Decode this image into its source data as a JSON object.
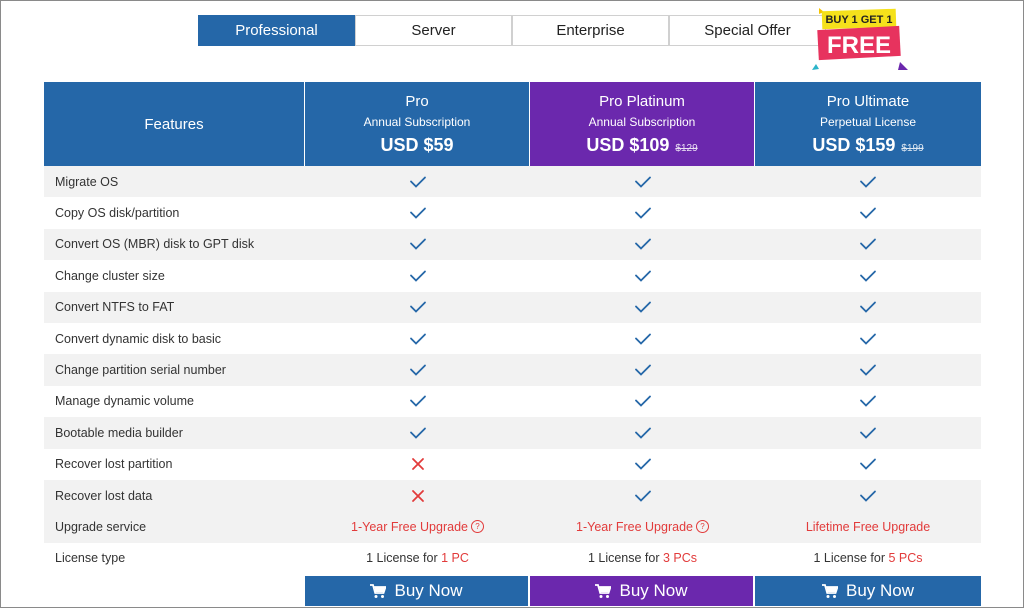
{
  "tabs": [
    "Professional",
    "Server",
    "Enterprise",
    "Special Offer"
  ],
  "promo": {
    "line1": "BUY 1 GET 1",
    "line2": "FREE"
  },
  "header": {
    "features_label": "Features",
    "plans": [
      {
        "name": "Pro",
        "subtitle": "Annual Subscription",
        "price": "USD $59",
        "old_price": ""
      },
      {
        "name": "Pro Platinum",
        "subtitle": "Annual Subscription",
        "price": "USD $109",
        "old_price": "$129"
      },
      {
        "name": "Pro Ultimate",
        "subtitle": "Perpetual License",
        "price": "USD $159",
        "old_price": "$199"
      }
    ]
  },
  "rows": [
    {
      "feature": "Migrate OS",
      "values": [
        "check",
        "check",
        "check"
      ]
    },
    {
      "feature": "Copy OS disk/partition",
      "values": [
        "check",
        "check",
        "check"
      ]
    },
    {
      "feature": "Convert OS (MBR) disk to GPT disk",
      "values": [
        "check",
        "check",
        "check"
      ]
    },
    {
      "feature": "Change cluster size",
      "values": [
        "check",
        "check",
        "check"
      ]
    },
    {
      "feature": "Convert NTFS to FAT",
      "values": [
        "check",
        "check",
        "check"
      ]
    },
    {
      "feature": "Convert dynamic disk to basic",
      "values": [
        "check",
        "check",
        "check"
      ]
    },
    {
      "feature": "Change partition serial number",
      "values": [
        "check",
        "check",
        "check"
      ]
    },
    {
      "feature": "Manage dynamic volume",
      "values": [
        "check",
        "check",
        "check"
      ]
    },
    {
      "feature": "Bootable media builder",
      "values": [
        "check",
        "check",
        "check"
      ]
    },
    {
      "feature": "Recover lost partition",
      "values": [
        "cross",
        "check",
        "check"
      ]
    },
    {
      "feature": "Recover lost data",
      "values": [
        "cross",
        "check",
        "check"
      ]
    }
  ],
  "upgrade": {
    "feature": "Upgrade service",
    "values": [
      "1-Year Free Upgrade",
      "1-Year Free Upgrade",
      "Lifetime Free Upgrade"
    ],
    "help": [
      true,
      true,
      false
    ]
  },
  "license": {
    "feature": "License type",
    "prefix": "1 License for",
    "values": [
      "1 PC",
      "3 PCs",
      "5 PCs"
    ]
  },
  "buy_label": "Buy Now",
  "icons": {
    "check": "check-icon",
    "cross": "cross-icon",
    "cart": "cart-icon",
    "help": "question-circle-icon"
  },
  "colors": {
    "blue": "#2567a8",
    "purple": "#6b28ad",
    "check": "#2567a8",
    "cross": "#e23b3b",
    "accent_red": "#e23b3b"
  }
}
